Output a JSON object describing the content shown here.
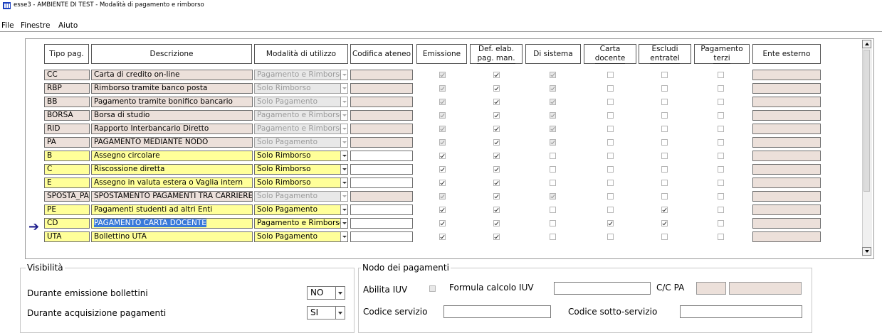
{
  "window": {
    "title": "esse3 - AMBIENTE DI TEST - Modalità di pagamento e rimborso"
  },
  "menu": [
    "File",
    "Finestre",
    "Aiuto"
  ],
  "columns": {
    "tipo": "Tipo pag.",
    "descrizione": "Descrizione",
    "modalita": "Modalità di utilizzo",
    "codifica": "Codifica ateneo",
    "emissione": "Emissione",
    "def_elab_1": "Def. elab.",
    "def_elab_2": "pag. man.",
    "di_sistema": "Di sistema",
    "carta_1": "Carta",
    "carta_2": "docente",
    "escludi_1": "Escludi",
    "escludi_2": "entratel",
    "pag_terzi_1": "Pagamento",
    "pag_terzi_2": "terzi",
    "ente": "Ente esterno"
  },
  "rows": [
    {
      "tipo": "CC",
      "descrizione": "Carta di credito on-line",
      "modalita": "Pagamento e Rimborso",
      "editable": false,
      "emissione": true,
      "def_elab": true,
      "di_sistema": true,
      "carta_docente": false,
      "escludi_entratel": false,
      "pagamento_terzi": false
    },
    {
      "tipo": "RBP",
      "descrizione": "Rimborso tramite banco posta",
      "modalita": "Solo Rimborso",
      "editable": false,
      "emissione": true,
      "def_elab": true,
      "di_sistema": true,
      "carta_docente": false,
      "escludi_entratel": false,
      "pagamento_terzi": false
    },
    {
      "tipo": "BB",
      "descrizione": "Pagamento tramite bonifico bancario",
      "modalita": "Solo Pagamento",
      "editable": false,
      "emissione": true,
      "def_elab": true,
      "di_sistema": true,
      "carta_docente": false,
      "escludi_entratel": false,
      "pagamento_terzi": false
    },
    {
      "tipo": "BORSA",
      "descrizione": "Borsa di studio",
      "modalita": "Pagamento e Rimborso",
      "editable": false,
      "emissione": true,
      "def_elab": true,
      "di_sistema": true,
      "carta_docente": false,
      "escludi_entratel": false,
      "pagamento_terzi": false
    },
    {
      "tipo": "RID",
      "descrizione": "Rapporto Interbancario Diretto",
      "modalita": "Pagamento e Rimborso",
      "editable": false,
      "emissione": true,
      "def_elab": true,
      "di_sistema": true,
      "carta_docente": false,
      "escludi_entratel": false,
      "pagamento_terzi": false
    },
    {
      "tipo": "PA",
      "descrizione": "PAGAMENTO MEDIANTE NODO",
      "modalita": "Solo Pagamento",
      "editable": false,
      "emissione": true,
      "def_elab": true,
      "di_sistema": true,
      "carta_docente": false,
      "escludi_entratel": false,
      "pagamento_terzi": false
    },
    {
      "tipo": "B",
      "descrizione": "Assegno circolare",
      "modalita": "Solo Rimborso",
      "editable": true,
      "emissione": true,
      "def_elab": true,
      "di_sistema": false,
      "carta_docente": false,
      "escludi_entratel": false,
      "pagamento_terzi": false
    },
    {
      "tipo": "C",
      "descrizione": "Riscossione diretta",
      "modalita": "Solo Rimborso",
      "editable": true,
      "emissione": true,
      "def_elab": true,
      "di_sistema": false,
      "carta_docente": false,
      "escludi_entratel": false,
      "pagamento_terzi": false
    },
    {
      "tipo": "E",
      "descrizione": "Assegno in valuta estera o Vaglia intern",
      "modalita": "Solo Rimborso",
      "editable": true,
      "emissione": true,
      "def_elab": true,
      "di_sistema": false,
      "carta_docente": false,
      "escludi_entratel": false,
      "pagamento_terzi": false
    },
    {
      "tipo": "SPOSTA_PA",
      "descrizione": "SPOSTAMENTO PAGAMENTI TRA CARRIERE",
      "modalita": "Solo Pagamento",
      "editable": false,
      "emissione": true,
      "def_elab": true,
      "di_sistema": true,
      "carta_docente": false,
      "escludi_entratel": false,
      "pagamento_terzi": false
    },
    {
      "tipo": "PE",
      "descrizione": "Pagamenti studenti ad altri Enti",
      "modalita": "Solo Pagamento",
      "editable": true,
      "emissione": true,
      "def_elab": true,
      "di_sistema": false,
      "carta_docente": false,
      "escludi_entratel": true,
      "pagamento_terzi": false
    },
    {
      "tipo": "CD",
      "descrizione": "PAGAMENTO CARTA DOCENTE",
      "modalita": "Pagamento e Rimborso",
      "editable": true,
      "current": true,
      "emissione": true,
      "def_elab": true,
      "di_sistema": false,
      "carta_docente": true,
      "escludi_entratel": true,
      "pagamento_terzi": false
    },
    {
      "tipo": "UTA",
      "descrizione": "Bollettino UTA",
      "modalita": "Solo Pagamento",
      "editable": true,
      "emissione": true,
      "def_elab": true,
      "di_sistema": false,
      "carta_docente": false,
      "escludi_entratel": false,
      "pagamento_terzi": false
    }
  ],
  "visibilita": {
    "title": "Visibilità",
    "emissione_label": "Durante emissione bollettini",
    "emissione_value": "NO",
    "acquisizione_label": "Durante acquisizione pagamenti",
    "acquisizione_value": "SI"
  },
  "nodo": {
    "title": "Nodo dei pagamenti",
    "abilita_iuv_label": "Abilita IUV",
    "abilita_iuv": false,
    "formula_label": "Formula calcolo IUV",
    "formula_value": "",
    "ccpa_label": "C/C PA",
    "codice_servizio_label": "Codice servizio",
    "codice_servizio_value": "",
    "codice_sotto_label": "Codice sotto-servizio",
    "codice_sotto_value": ""
  },
  "colors": {
    "editable_row": "#ffff99",
    "readonly_row": "#ece0da",
    "selection": "#3879d9",
    "arrow_indicator": "#1c1c8c"
  },
  "icons": {
    "current_row": "arrow-right-icon",
    "app": "esse3-app-icon"
  }
}
